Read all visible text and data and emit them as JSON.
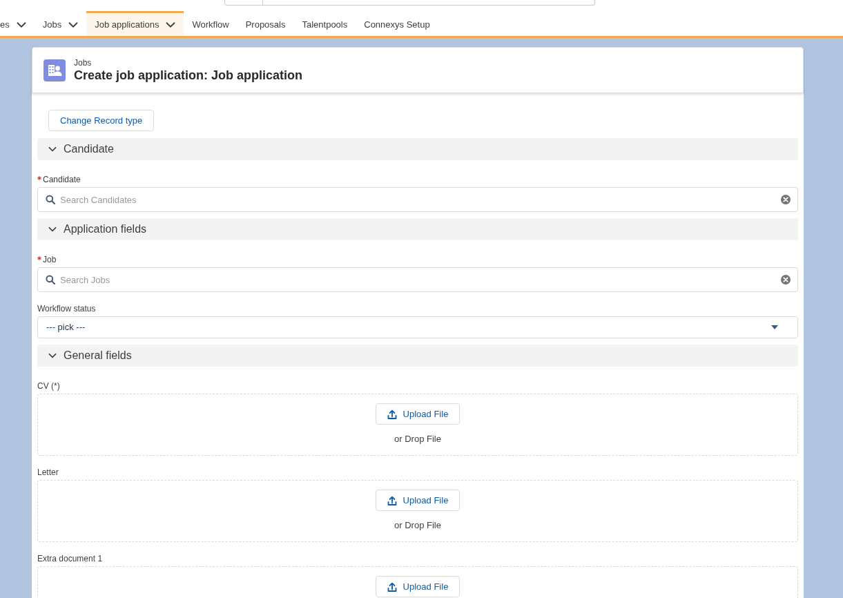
{
  "nav_tabs": [
    {
      "label": "es",
      "has_menu": true,
      "selected": false
    },
    {
      "label": "Jobs",
      "has_menu": true,
      "selected": false
    },
    {
      "label": "Job applications",
      "has_menu": true,
      "selected": true
    },
    {
      "label": "Workflow",
      "has_menu": false,
      "selected": false
    },
    {
      "label": "Proposals",
      "has_menu": false,
      "selected": false
    },
    {
      "label": "Talentpools",
      "has_menu": false,
      "selected": false
    },
    {
      "label": "Connexys Setup",
      "has_menu": false,
      "selected": false
    }
  ],
  "page_header": {
    "object_name": "Jobs",
    "title": "Create job application: Job application"
  },
  "record_type_button": "Change Record type",
  "sections": [
    {
      "title": "Candidate",
      "expanded": true,
      "fields": [
        {
          "kind": "lookup",
          "label": "Candidate",
          "required": true,
          "placeholder": "Search Candidates"
        }
      ]
    },
    {
      "title": "Application fields",
      "expanded": true,
      "fields": [
        {
          "kind": "lookup",
          "label": "Job",
          "required": true,
          "placeholder": "Search Jobs"
        },
        {
          "kind": "select",
          "label": "Workflow status",
          "required": false,
          "value": "--- pick ---"
        }
      ]
    },
    {
      "title": "General fields",
      "expanded": true,
      "fields": [
        {
          "kind": "file",
          "label": "CV (*)",
          "required": false,
          "button": "Upload File",
          "drop_hint": "or Drop File"
        },
        {
          "kind": "file",
          "label": "Letter",
          "required": false,
          "button": "Upload File",
          "drop_hint": "or Drop File"
        },
        {
          "kind": "file",
          "label": "Extra document 1",
          "required": false,
          "button": "Upload File"
        }
      ]
    }
  ]
}
